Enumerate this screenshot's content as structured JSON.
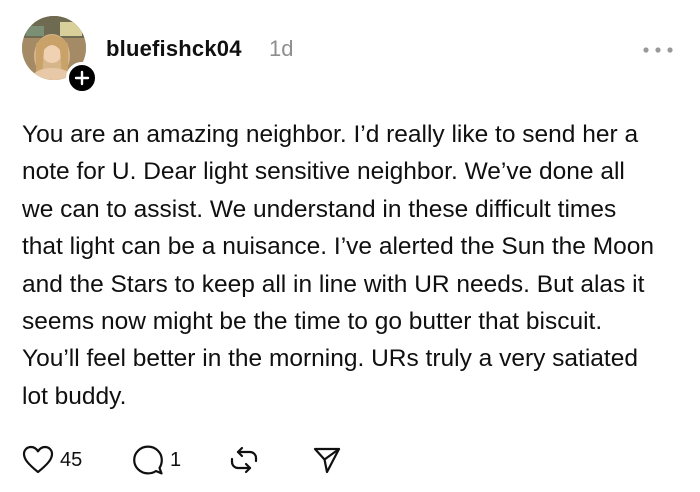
{
  "post": {
    "username": "bluefishck04",
    "timestamp": "1d",
    "follow_symbol": "+",
    "text": "You are an amazing neighbor. I’d really like to send her a note for U. Dear light sensitive neighbor. We’ve done all we can to assist. We understand in these difficult times that light can be a nuisance. I’ve alerted the Sun the Moon and the Stars to keep all in line with UR needs. But alas it seems now might be the time to go butter that biscuit. You’ll feel better in the morning. URs truly a very satiated lot buddy.",
    "actions": {
      "like_count": "45",
      "reply_count": "1"
    }
  },
  "icons": {
    "like": "heart-icon",
    "reply": "speech-bubble-icon",
    "repost": "repost-icon",
    "share": "send-icon",
    "more": "more-dots-icon",
    "follow": "plus-icon"
  },
  "colors": {
    "text": "#101010",
    "muted": "#8e8e8e",
    "background": "#ffffff"
  }
}
